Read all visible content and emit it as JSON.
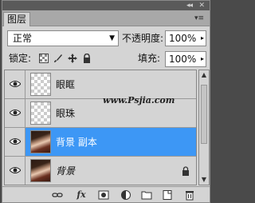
{
  "panel": {
    "tab_label": "图层",
    "collapse_glyph": "◂◂",
    "close_glyph": "✕",
    "menu_glyph": "▾≡"
  },
  "blend_mode": {
    "value": "正常",
    "arrow": "▼"
  },
  "opacity": {
    "label": "不透明度:",
    "value": "100%",
    "arrow": "▸"
  },
  "lock": {
    "label": "锁定:"
  },
  "fill": {
    "label": "填充:",
    "value": "100%",
    "arrow": "▸"
  },
  "layers": [
    {
      "name": "眼眶",
      "thumb": "transparent",
      "visible": true,
      "selected": false
    },
    {
      "name": "眼珠",
      "thumb": "transparent",
      "visible": true,
      "selected": false
    },
    {
      "name": "背景 副本",
      "thumb": "photo",
      "visible": true,
      "selected": true
    },
    {
      "name": "背景",
      "thumb": "photo",
      "visible": true,
      "selected": false,
      "locked": true
    }
  ],
  "watermark": "www.Psjia.com",
  "footer": {
    "fx_label": "fx"
  },
  "colors": {
    "selection": "#3d97f5",
    "panel_bg": "#d4d4d4"
  }
}
